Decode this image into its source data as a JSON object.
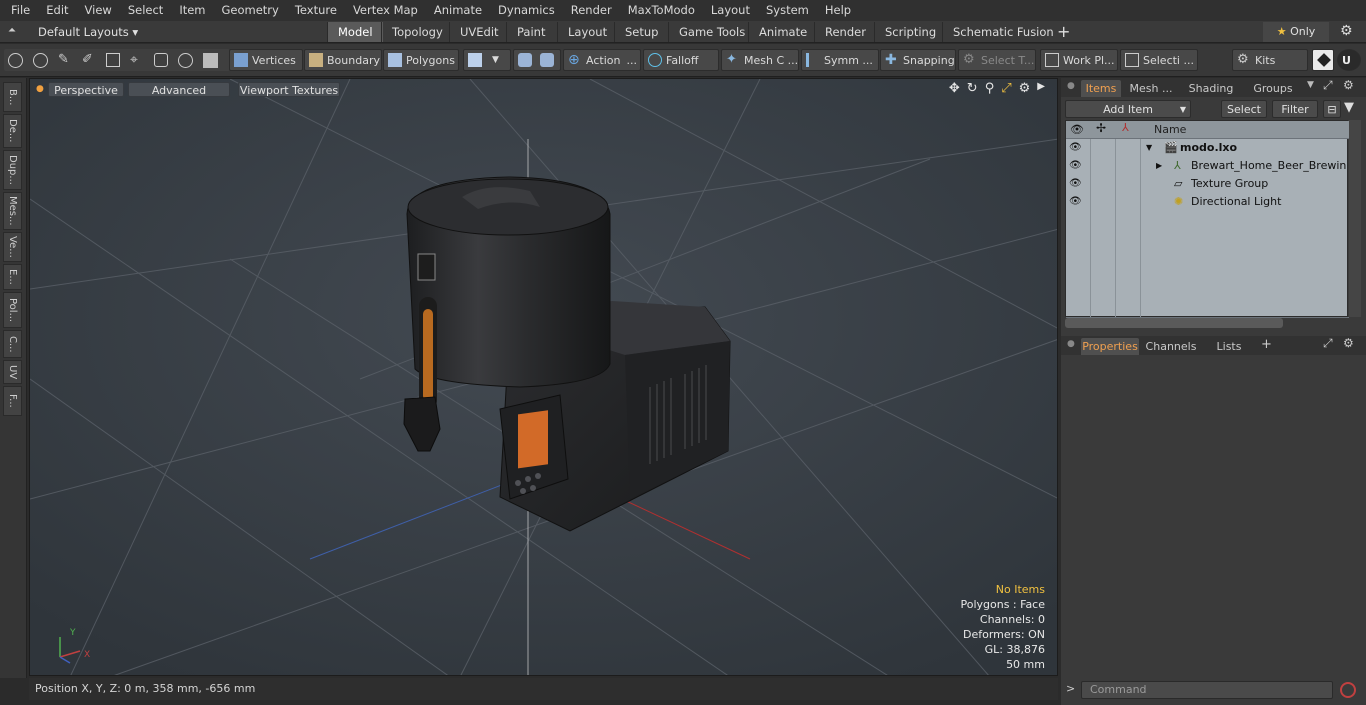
{
  "menu": [
    "File",
    "Edit",
    "View",
    "Select",
    "Item",
    "Geometry",
    "Texture",
    "Vertex Map",
    "Animate",
    "Dynamics",
    "Render",
    "MaxToModo",
    "Layout",
    "System",
    "Help"
  ],
  "layout_bar": {
    "layouts_label": "Default Layouts",
    "tabs": [
      "Model",
      "Topology",
      "UVEdit",
      "Paint",
      "Layout",
      "Setup",
      "Game Tools",
      "Animate",
      "Render",
      "Scripting",
      "Schematic Fusion"
    ],
    "active_tab": "Model",
    "add_label": "+",
    "only_label": "Only",
    "star": "★"
  },
  "toolbar": {
    "vertices": "Vertices",
    "boundary": "Boundary",
    "polygons": "Polygons",
    "action": "Action",
    "falloff": "Falloff",
    "mesh": "Mesh C ...",
    "symmetry": "Symm ...",
    "snapping": "Snapping",
    "select_t": "Select T...",
    "workplane": "Work Pl...",
    "selection": "Selecti ...",
    "kits": "Kits"
  },
  "left_tabs": [
    "B...",
    "De...",
    "Dup...",
    "Mes...",
    "Ve...",
    "E...",
    "Pol...",
    "C...",
    "UV",
    "F..."
  ],
  "viewport": {
    "perspective": "Perspective",
    "advanced": "Advanced",
    "textures": "Viewport Textures",
    "info": {
      "no_items": "No Items",
      "polygons": "Polygons : Face",
      "channels": "Channels: 0",
      "deformers": "Deformers: ON",
      "gl": "GL: 38,876",
      "size": "50 mm"
    },
    "colors": {
      "no_items": "#f0c040",
      "bg": "#3b4148"
    }
  },
  "status": {
    "position": "Position X, Y, Z:   0 m, 358 mm, -656 mm"
  },
  "right_panel": {
    "tabs": [
      "Items",
      "Mesh ...",
      "Shading",
      "Groups"
    ],
    "active_tab": "Items",
    "add_item": "Add Item",
    "select": "Select",
    "filter": "Filter",
    "column_name": "Name",
    "items": [
      {
        "label": "modo.lxo",
        "bold": true
      },
      {
        "label": "Brewart_Home_Beer_Brewin ..."
      },
      {
        "label": "Texture Group"
      },
      {
        "label": "Directional Light"
      }
    ],
    "bottom_tabs": [
      "Properties",
      "Channels",
      "Lists"
    ],
    "bottom_active": "Properties",
    "bottom_add": "+",
    "command_placeholder": "Command",
    "prompt": ">"
  }
}
